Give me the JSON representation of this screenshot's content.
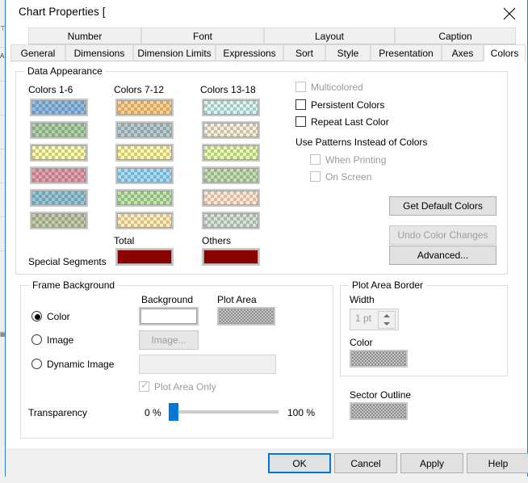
{
  "window": {
    "title": "Chart Properties [",
    "close_icon": "close-icon"
  },
  "tabs": {
    "row1": [
      {
        "label": "Number"
      },
      {
        "label": "Font"
      },
      {
        "label": "Layout"
      },
      {
        "label": "Caption"
      }
    ],
    "row2": [
      {
        "label": "General",
        "selected": false
      },
      {
        "label": "Dimensions",
        "selected": false
      },
      {
        "label": "Dimension Limits",
        "selected": false
      },
      {
        "label": "Expressions",
        "selected": false
      },
      {
        "label": "Sort",
        "selected": false
      },
      {
        "label": "Style",
        "selected": false
      },
      {
        "label": "Presentation",
        "selected": false
      },
      {
        "label": "Axes",
        "selected": false
      },
      {
        "label": "Colors",
        "selected": true
      }
    ]
  },
  "data_appearance": {
    "group_title": "Data Appearance",
    "column_headers": [
      "Colors 1-6",
      "Colors 7-12",
      "Colors 13-18"
    ],
    "colors_1_6": [
      "#7fa8cc",
      "#9dbb95",
      "#e0de98",
      "#cc8e99",
      "#84b2c2",
      "#adb694"
    ],
    "colors_7_12": [
      "#e8b979",
      "#a4b5bb",
      "#ecdf93",
      "#8fc6e0",
      "#a8cc95",
      "#f0d3a0"
    ],
    "colors_13_18": [
      "#bcdcd8",
      "#dbd5c2",
      "#ccde95",
      "#aec79e",
      "#f2cdbc",
      "#bccbbe"
    ],
    "special_segments_label": "Special Segments",
    "total_label": "Total",
    "others_label": "Others",
    "total_color": "#8b0000",
    "others_color": "#8b0000"
  },
  "options": {
    "multicolored": {
      "label": "Multicolored",
      "checked": false,
      "enabled": false
    },
    "persistent_colors": {
      "label": "Persistent Colors",
      "checked": false,
      "enabled": true
    },
    "repeat_last_color": {
      "label": "Repeat Last Color",
      "checked": false,
      "enabled": true
    },
    "use_patterns_label": "Use Patterns Instead of Colors",
    "when_printing": {
      "label": "When Printing",
      "checked": false,
      "enabled": false
    },
    "on_screen": {
      "label": "On Screen",
      "checked": false,
      "enabled": false
    },
    "get_default_colors": {
      "label": "Get Default Colors",
      "enabled": true
    },
    "undo_color_changes": {
      "label": "Undo Color Changes",
      "enabled": false
    },
    "advanced": {
      "label": "Advanced...",
      "enabled": true
    }
  },
  "frame_background": {
    "group_title": "Frame Background",
    "background_label": "Background",
    "plot_area_label": "Plot Area",
    "color_radio": {
      "label": "Color",
      "selected": true
    },
    "image_radio": {
      "label": "Image",
      "selected": false
    },
    "dynamic_image_radio": {
      "label": "Dynamic Image",
      "selected": false
    },
    "image_button": {
      "label": "Image...",
      "enabled": false
    },
    "dynamic_image_value": "",
    "plot_area_only": {
      "label": "Plot Area Only",
      "checked": true,
      "enabled": false,
      "tick": "✓"
    },
    "transparency_label": "Transparency",
    "transparency_min": "0 %",
    "transparency_max": "100 %",
    "transparency_value": 0,
    "background_swatch_color": "#ffffff",
    "slider_accent": "#0078d7"
  },
  "plot_area_border": {
    "group_title": "Plot Area Border",
    "width_label": "Width",
    "width_value": "1 pt",
    "color_label": "Color"
  },
  "sector_outline": {
    "label": "Sector Outline"
  },
  "footer": {
    "ok": "OK",
    "cancel": "Cancel",
    "apply": "Apply",
    "help": "Help"
  }
}
